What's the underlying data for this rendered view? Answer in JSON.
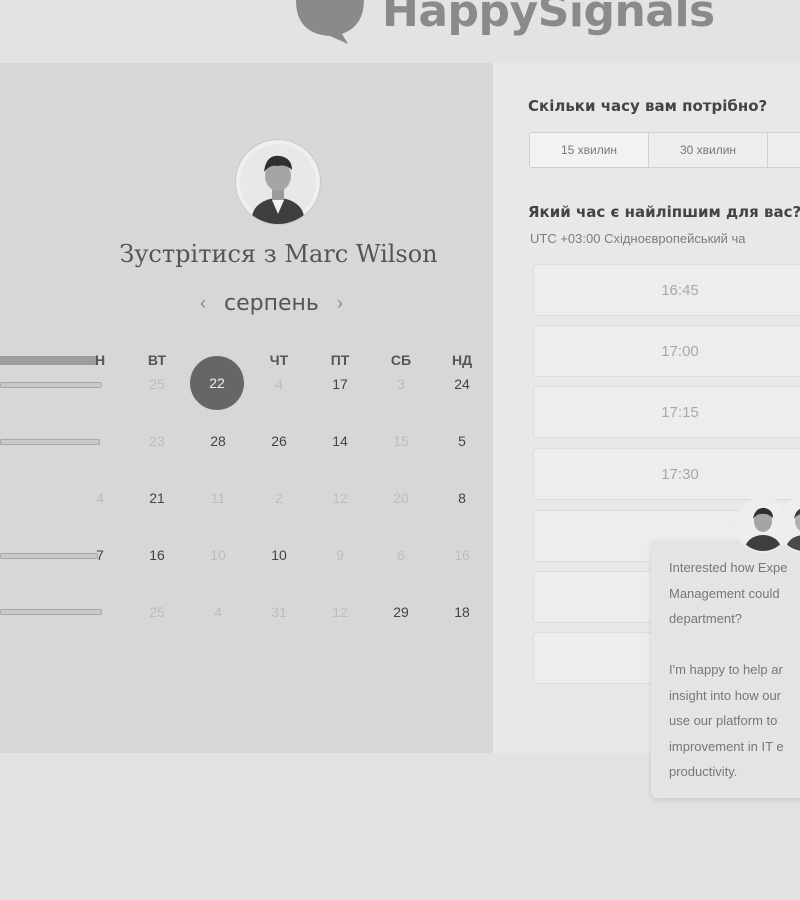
{
  "brand": {
    "name": "HappySignals"
  },
  "calendar": {
    "title": "Зустрітися з Marc Wilson",
    "month": "серпень",
    "weekdays": [
      "ВТ",
      "ЧТ",
      "ПТ",
      "СБ",
      "НД"
    ],
    "selected_day": "22",
    "rows": [
      [
        {
          "v": "25",
          "a": false
        },
        {
          "v": "4",
          "a": false
        },
        {
          "v": "17",
          "a": true
        },
        {
          "v": "3",
          "a": false
        },
        {
          "v": "24",
          "a": true
        }
      ],
      [
        {
          "v": "23",
          "a": false
        },
        {
          "v": "28",
          "a": true
        },
        {
          "v": "26",
          "a": true
        },
        {
          "v": "14",
          "a": true
        },
        {
          "v": "15",
          "a": false
        },
        {
          "v": "5",
          "a": true
        }
      ],
      [
        {
          "v": "4",
          "a": false
        },
        {
          "v": "21",
          "a": true
        },
        {
          "v": "11",
          "a": false
        },
        {
          "v": "2",
          "a": false
        },
        {
          "v": "12",
          "a": false
        },
        {
          "v": "20",
          "a": false
        },
        {
          "v": "8",
          "a": true
        }
      ],
      [
        {
          "v": "7",
          "a": true
        },
        {
          "v": "16",
          "a": true
        },
        {
          "v": "10",
          "a": false
        },
        {
          "v": "10",
          "a": true
        },
        {
          "v": "9",
          "a": false
        },
        {
          "v": "6",
          "a": false
        },
        {
          "v": "16",
          "a": false
        }
      ],
      [
        {
          "v": "25",
          "a": false
        },
        {
          "v": "4",
          "a": false
        },
        {
          "v": "31",
          "a": false
        },
        {
          "v": "12",
          "a": false
        },
        {
          "v": "29",
          "a": true
        },
        {
          "v": "18",
          "a": true
        }
      ]
    ]
  },
  "booking": {
    "duration_title": "Скільки часу вам потрібно?",
    "durations": [
      "15 хвилин",
      "30 хвилин"
    ],
    "time_title": "Який час є найліпшим для вас?",
    "timezone": "UTC +03:00 Східноєвропейський ча",
    "slots": [
      "16:45",
      "17:00",
      "17:15",
      "17:30"
    ]
  },
  "chat": {
    "lines": [
      "Interested how Expe",
      "Management could",
      "department?",
      "",
      "I'm happy to help ar",
      "insight into how our",
      "use our platform to",
      "improvement in IT e",
      "productivity."
    ]
  }
}
